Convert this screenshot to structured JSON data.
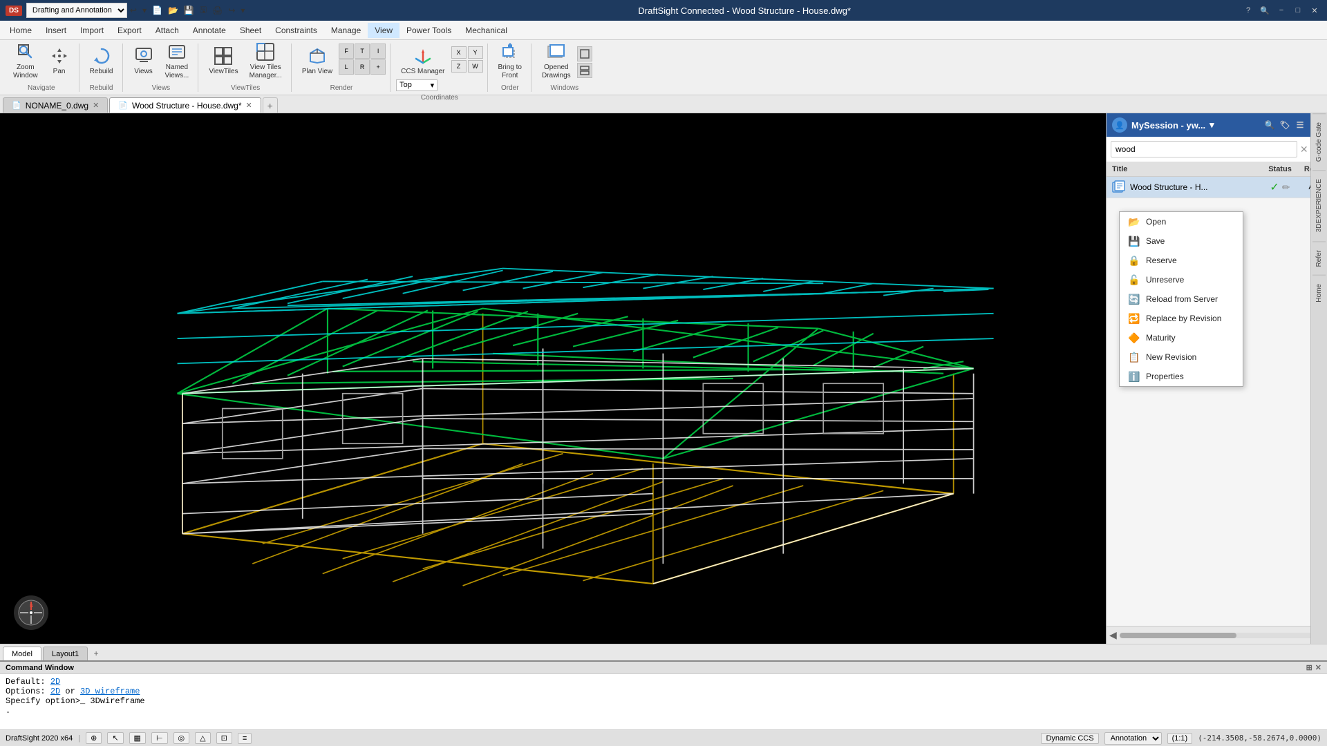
{
  "app": {
    "title": "DraftSight Connected - Wood Structure - House.dwg*",
    "logo": "DS",
    "version": "DraftSight 2020 x64"
  },
  "titlebar": {
    "title": "DraftSight Connected - Wood Structure - House.dwg*",
    "minimize": "−",
    "maximize": "□",
    "close": "✕"
  },
  "workspace": {
    "current": "Drafting and Annotation"
  },
  "menubar": {
    "items": [
      "Home",
      "Insert",
      "Import",
      "Export",
      "Attach",
      "Annotate",
      "Sheet",
      "Constraints",
      "Manage",
      "View",
      "Power Tools",
      "Mechanical"
    ]
  },
  "toolbar": {
    "navigate": {
      "label": "Navigate",
      "zoom_window": "Zoom\nWindow",
      "pan": "Pan"
    },
    "rebuild": {
      "label": "Rebuild",
      "rebuild": "Rebuild"
    },
    "views": {
      "label": "Views",
      "views": "Views",
      "named_views": "Named\nViews...",
      "top": "Top"
    },
    "viewtiles": {
      "label": "ViewTiles",
      "view_tiles": "ViewTiles",
      "view_tiles_manager": "View Tiles\nManager..."
    },
    "render": {
      "label": "Render",
      "plan_view": "Plan View"
    },
    "coordinates": {
      "label": "Coordinates",
      "ccs_manager": "CCS\nManager"
    },
    "order": {
      "label": "Order",
      "bring_to_front": "Bring to\nFront"
    },
    "windows": {
      "label": "Windows",
      "opened_drawings": "Opened\nDrawings"
    }
  },
  "tabs": {
    "items": [
      {
        "label": "NONAME_0.dwg",
        "active": false
      },
      {
        "label": "Wood Structure - House.dwg*",
        "active": true
      }
    ],
    "add_tooltip": "New tab"
  },
  "coord_dropdown": {
    "current": "Top"
  },
  "right_panel": {
    "title": "MySession - yw...",
    "search_placeholder": "wood",
    "search_value": "wood",
    "table_headers": {
      "title": "Title",
      "status": "Status",
      "rev": "Rev"
    },
    "items": [
      {
        "name": "Wood Structure - H...",
        "status_check": true,
        "status_edit": true
      }
    ],
    "context_menu": {
      "items": [
        {
          "label": "Open",
          "icon": "📂"
        },
        {
          "label": "Save",
          "icon": "💾"
        },
        {
          "label": "Reserve",
          "icon": "🔒"
        },
        {
          "label": "Unreserve",
          "icon": "🔓"
        },
        {
          "label": "Reload from Server",
          "icon": "🔄"
        },
        {
          "label": "Replace by Revision",
          "icon": "🔁"
        },
        {
          "label": "Maturity",
          "icon": "🔶"
        },
        {
          "label": "New Revision",
          "icon": "📋"
        },
        {
          "label": "Properties",
          "icon": "ℹ️"
        }
      ]
    },
    "side_tabs": [
      "G-code Gate",
      "3DEXPERIENCE",
      "Refer",
      "Home"
    ]
  },
  "bottom_tabs": {
    "items": [
      {
        "label": "Model",
        "active": true
      },
      {
        "label": "Layout1",
        "active": false
      }
    ]
  },
  "command_window": {
    "title": "Command Window",
    "lines": [
      "Default: 2D",
      "Options: 2D or 3D wireframe",
      "Specify option>_ 3Dwireframe",
      "."
    ],
    "link_2d": "2D",
    "link_3d": "3D wireframe"
  },
  "statusbar": {
    "version": "DraftSight 2020 x64",
    "snap_toggle": "⊕",
    "cursor_toggle": "↖",
    "grid_toggle": "▦",
    "ortho_toggle": "⊢",
    "polar_toggle": "◎",
    "snap_obj_toggle": "△",
    "dyn_toggle": "⊡",
    "lineweight_toggle": "≡",
    "dynamic_ccs": "Dynamic CCS",
    "annotation": "Annotation",
    "annotation_dropdown": "▾",
    "scale": "(1:1)",
    "coords": "(-214.3508,-58.2674,0.0000)"
  }
}
